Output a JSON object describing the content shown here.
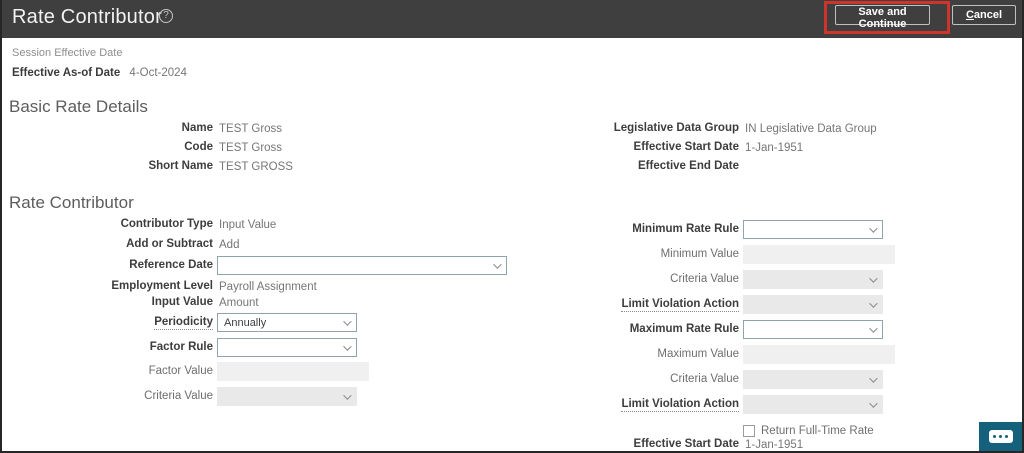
{
  "header": {
    "title": "Rate Contributor",
    "help_glyph": "?",
    "save_button": "Save and Continue",
    "cancel_accel": "C",
    "cancel_rest": "ancel"
  },
  "session": {
    "section_label": "Session Effective Date",
    "effective_asof_label": "Effective As-of Date",
    "effective_asof_value": "4-Oct-2024"
  },
  "basic": {
    "heading": "Basic Rate Details",
    "left": [
      {
        "label": "Name",
        "value": "TEST Gross"
      },
      {
        "label": "Code",
        "value": "TEST Gross"
      },
      {
        "label": "Short Name",
        "value": "TEST GROSS"
      }
    ],
    "right": [
      {
        "label": "Legislative Data Group",
        "value": "IN Legislative Data Group"
      },
      {
        "label": "Effective Start Date",
        "value": "1-Jan-1951"
      },
      {
        "label": "Effective End Date",
        "value": ""
      }
    ]
  },
  "rc": {
    "heading": "Rate Contributor",
    "left": [
      {
        "label": "Contributor Type",
        "value": "Input Value",
        "type": "readonly"
      },
      {
        "label": "Add or Subtract",
        "value": "Add",
        "type": "readonly"
      },
      {
        "label": "Reference Date",
        "value": "",
        "type": "select"
      },
      {
        "label": "Employment Level",
        "value": "Payroll Assignment",
        "type": "readonly"
      },
      {
        "label": "Input Value",
        "value": "Amount",
        "type": "readonly"
      },
      {
        "label": "Periodicity",
        "value": "Annually",
        "type": "select"
      },
      {
        "label": "Factor Rule",
        "value": "",
        "type": "select"
      },
      {
        "label": "Factor Value",
        "value": "",
        "type": "input-disabled"
      },
      {
        "label": "Criteria Value",
        "value": "",
        "type": "select-disabled"
      }
    ],
    "right": [
      {
        "label": "Minimum Rate Rule",
        "value": "",
        "type": "select"
      },
      {
        "label": "Minimum Value",
        "value": "",
        "type": "input-disabled"
      },
      {
        "label": "Criteria Value",
        "value": "",
        "type": "select-disabled"
      },
      {
        "label": "Limit Violation Action",
        "value": "",
        "type": "select-disabled"
      },
      {
        "label": "Maximum Rate Rule",
        "value": "",
        "type": "select"
      },
      {
        "label": "Maximum Value",
        "value": "",
        "type": "input-disabled"
      },
      {
        "label": "Criteria Value",
        "value": "",
        "type": "select-disabled"
      },
      {
        "label": "Limit Violation Action",
        "value": "",
        "type": "select-disabled"
      },
      {
        "label": "Return Full-Time Rate",
        "type": "checkbox",
        "checked": false
      },
      {
        "label": "Effective Start Date",
        "value": "1-Jan-1951",
        "type": "readonly"
      }
    ]
  },
  "colors": {
    "header_bg": "#3f3f3f",
    "annotation_red": "#cf342b",
    "chat_teal": "#15607a",
    "disabled_bg": "#e9e9e9",
    "select_border": "#8fa4ad"
  }
}
